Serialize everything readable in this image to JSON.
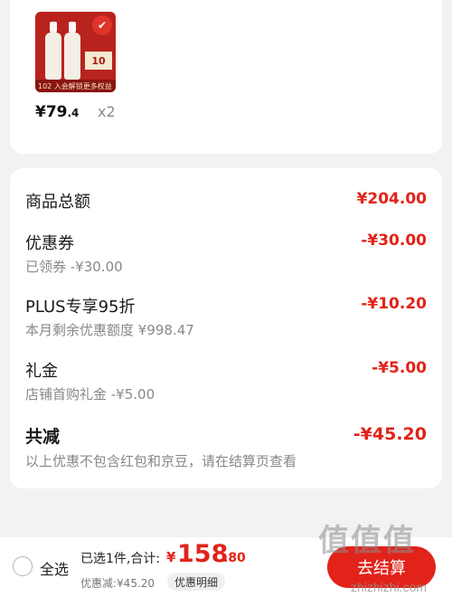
{
  "product": {
    "image_badge": "✔",
    "image_tag": "10",
    "image_band_text": "102 入会解锁更多权益",
    "price_int": "¥79",
    "price_dec": ".4",
    "quantity": "x2"
  },
  "summary": {
    "rows": [
      {
        "label": "商品总额",
        "amount": "¥204.00"
      },
      {
        "label": "优惠券",
        "sub": "已领券 -¥30.00",
        "amount": "-¥30.00"
      },
      {
        "label": "PLUS专享95折",
        "sub": "本月剩余优惠额度 ¥998.47",
        "amount": "-¥10.20"
      },
      {
        "label": "礼金",
        "sub": "店铺首购礼金 -¥5.00",
        "amount": "-¥5.00"
      },
      {
        "label": "共减",
        "sub": "以上优惠不包含红包和京豆，请在结算页查看",
        "amount": "-¥45.20"
      }
    ]
  },
  "bottom_bar": {
    "select_all": "全选",
    "selected_text": "已选1件,合计:",
    "total_sign": "¥",
    "total_int": "158",
    "total_dec": ".80",
    "discount_text": "优惠减:¥45.20",
    "detail_button": "优惠明细",
    "checkout_button": "去结算"
  },
  "watermark": {
    "text": "值值值",
    "url": "zhizhizhi.com"
  },
  "colors": {
    "accent": "#e2231a",
    "background": "#f2f2f2"
  }
}
